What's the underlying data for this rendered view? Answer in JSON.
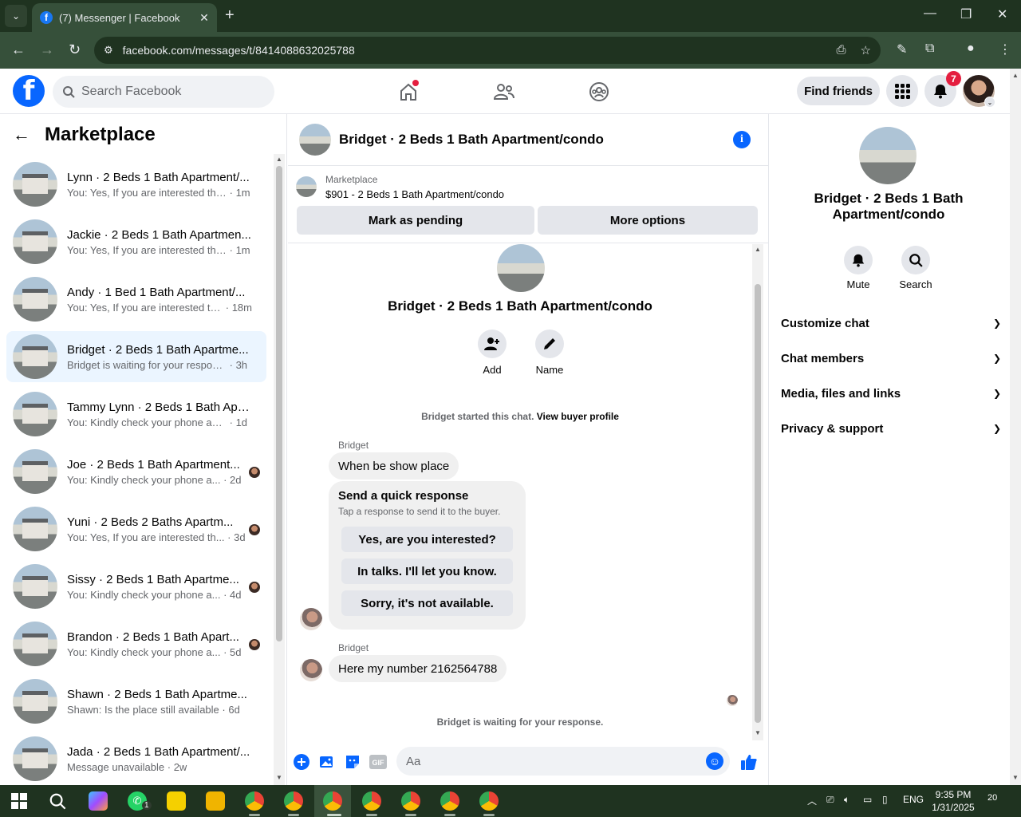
{
  "browser": {
    "tab_title": "(7) Messenger | Facebook",
    "url": "facebook.com/messages/t/8414088632025788"
  },
  "fb_header": {
    "search_placeholder": "Search Facebook",
    "find_friends_label": "Find friends",
    "notification_count": "7"
  },
  "sidebar": {
    "title": "Marketplace",
    "conversations": [
      {
        "name": "Lynn · 2 Beds 1 Bath Apartment/...",
        "preview": "You: Yes, If you are interested then...",
        "time": "1m",
        "active": false
      },
      {
        "name": "Jackie · 2 Beds 1 Bath Apartmen...",
        "preview": "You: Yes, If you are interested then...",
        "time": "1m",
        "active": false
      },
      {
        "name": "Andy · 1 Bed 1 Bath Apartment/...",
        "preview": "You: Yes, If you are interested the...",
        "time": "18m",
        "active": false
      },
      {
        "name": "Bridget · 2 Beds 1 Bath Apartme...",
        "preview": "Bridget is waiting for your response.",
        "time": "3h",
        "active": true
      },
      {
        "name": "Tammy Lynn · 2 Beds 1 Bath Apa...",
        "preview": "You: Kindly check your phone and I...",
        "time": "1d",
        "active": false
      },
      {
        "name": "Joe · 2 Beds 1 Bath Apartment...",
        "preview": "You: Kindly check your phone a...",
        "time": "2d",
        "active": false
      },
      {
        "name": "Yuni · 2 Beds 2 Baths Apartm...",
        "preview": "You: Yes, If you are interested th...",
        "time": "3d",
        "active": false
      },
      {
        "name": "Sissy · 2 Beds 1 Bath Apartme...",
        "preview": "You: Kindly check your phone a...",
        "time": "4d",
        "active": false
      },
      {
        "name": "Brandon · 2 Beds 1 Bath Apart...",
        "preview": "You: Kindly check your phone a...",
        "time": "5d",
        "active": false
      },
      {
        "name": "Shawn · 2 Beds 1 Bath Apartme...",
        "preview": "Shawn: Is the place still available",
        "time": "6d",
        "active": false
      },
      {
        "name": "Jada · 2 Beds 1 Bath Apartment/...",
        "preview": "Message unavailable",
        "time": "2w",
        "active": false
      }
    ]
  },
  "chat": {
    "title": "Bridget · 2 Beds 1 Bath Apartment/condo",
    "listing_label": "Marketplace",
    "listing_price": "$901 - 2 Beds 1 Bath Apartment/condo",
    "mark_pending": "Mark as pending",
    "more_options": "More options",
    "add_label": "Add",
    "name_label": "Name",
    "started_text": "Bridget started this chat.",
    "view_profile": "View buyer profile",
    "sender": "Bridget",
    "msg1": "When be show place",
    "quick_title": "Send a quick response",
    "quick_sub": "Tap a response to send it to the buyer.",
    "quick_options": [
      "Yes, are you interested?",
      "In talks. I'll let you know.",
      "Sorry, it's not available."
    ],
    "msg2": "Here my number 2162564788",
    "waiting": "Bridget is waiting for your response.",
    "composer_placeholder": "Aa"
  },
  "info_panel": {
    "name": "Bridget · 2 Beds 1 Bath Apartment/condo",
    "mute_label": "Mute",
    "search_label": "Search",
    "sections": [
      "Customize chat",
      "Chat members",
      "Media, files and links",
      "Privacy & support"
    ]
  },
  "taskbar": {
    "whatsapp_badge": "1",
    "lang": "ENG",
    "time": "9:35 PM",
    "date": "1/31/2025",
    "notif_count": "20"
  },
  "colors": {
    "fb_blue": "#0866ff",
    "active_conv": "#ebf5ff",
    "badge_red": "#e41e3f",
    "chrome_dark": "#1f3320"
  }
}
